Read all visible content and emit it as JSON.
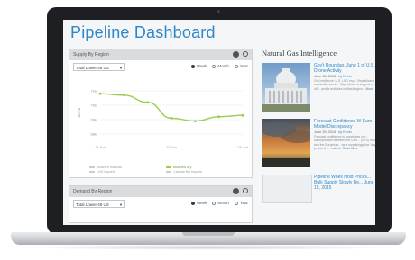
{
  "dashboard": {
    "title": "Pipeline Dashboard"
  },
  "supply_panel": {
    "header": "Supply By Region",
    "select_value": "Total Lower 48 US",
    "radios": [
      {
        "label": "Week",
        "selected": true
      },
      {
        "label": "Month",
        "selected": false
      },
      {
        "label": "Year",
        "selected": false
      }
    ],
    "legend": [
      "Modeled Railroad",
      "Modeled Dry",
      "LNG Imports",
      "Canada Net Imports"
    ]
  },
  "demand_panel": {
    "header": "Demand By Region",
    "select_value": "Total Lower 48 US",
    "radios": [
      {
        "label": "Week",
        "selected": true
      },
      {
        "label": "Month",
        "selected": false
      },
      {
        "label": "Year",
        "selected": false
      }
    ]
  },
  "news": {
    "title": "Natural Gas Intelligence",
    "items": [
      {
        "headline": "Gov't Roundup, June 1 of U.S. Drone Activity",
        "date": "June 15, 2015",
        "author": "by Kevin",
        "body": "Grid resilience: U.S. LNG exp... Republicans in nationality and in... Republican in support of offi... profile activities in Washington...",
        "more": "More"
      },
      {
        "headline": "Forecast Confidence W Euro Model Discrepancy",
        "date": "June 15, 2015",
        "author": "by Kevin",
        "body": "Forecast confidence is sometimes low... discrepancies between the GFS... (GFS) model and the European... as a surprisingly low 'day 6' period of t... outlook.",
        "more": "Read More"
      },
      {
        "headline": "Pipeline Woes Hold Prices... Bulk Supply Slowly Re... June 15, 2015",
        "date": "",
        "author": "",
        "body": "",
        "more": ""
      }
    ]
  },
  "colors": {
    "accent": "#2f87c9",
    "series_green": "#9ccc4e"
  },
  "chart_data": {
    "type": "line",
    "x": [
      "11 Jun",
      "12 Jun",
      "13 Jun",
      "14 Jun",
      "15 Jun",
      "16 Jun",
      "17 Jun"
    ],
    "x_tick_labels": [
      "11 Jun",
      "12 Jun",
      "13 Jun"
    ],
    "series": [
      {
        "name": "Modeled Dry",
        "values": [
          70.8,
          70.7,
          70.2,
          69.1,
          68.9,
          69.2,
          69.3
        ]
      }
    ],
    "ylabel": "BCF/D",
    "y_tick_labels": [
      "71k",
      "70k",
      "69k",
      "68k"
    ],
    "ylim": [
      67.5,
      71.5
    ],
    "grid": true
  }
}
